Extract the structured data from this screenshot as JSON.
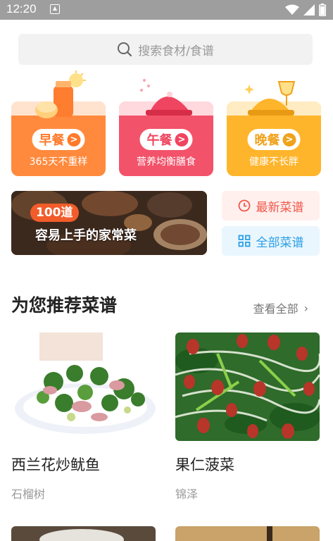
{
  "status_bar": {
    "time": "12:20"
  },
  "search": {
    "placeholder": "搜索食材/食谱"
  },
  "meals": [
    {
      "label": "早餐",
      "subtitle": "365天不重样",
      "color": "#ff8a3d"
    },
    {
      "label": "午餐",
      "subtitle": "营养均衡膳食",
      "color": "#f2536a"
    },
    {
      "label": "晚餐",
      "subtitle": "健康不长胖",
      "color": "#ffb52b"
    }
  ],
  "banner": {
    "badge": "100道",
    "title": "容易上手的家常菜"
  },
  "quick_links": {
    "latest": {
      "label": "最新菜谱",
      "color": "#f0584a"
    },
    "all": {
      "label": "全部菜谱",
      "color": "#2a9fe6"
    }
  },
  "recommend": {
    "title": "为您推荐菜谱",
    "view_all": "查看全部",
    "items": [
      {
        "name": "西兰花炒鱿鱼",
        "author": "石榴树"
      },
      {
        "name": "果仁菠菜",
        "author": "锦泽"
      }
    ]
  }
}
